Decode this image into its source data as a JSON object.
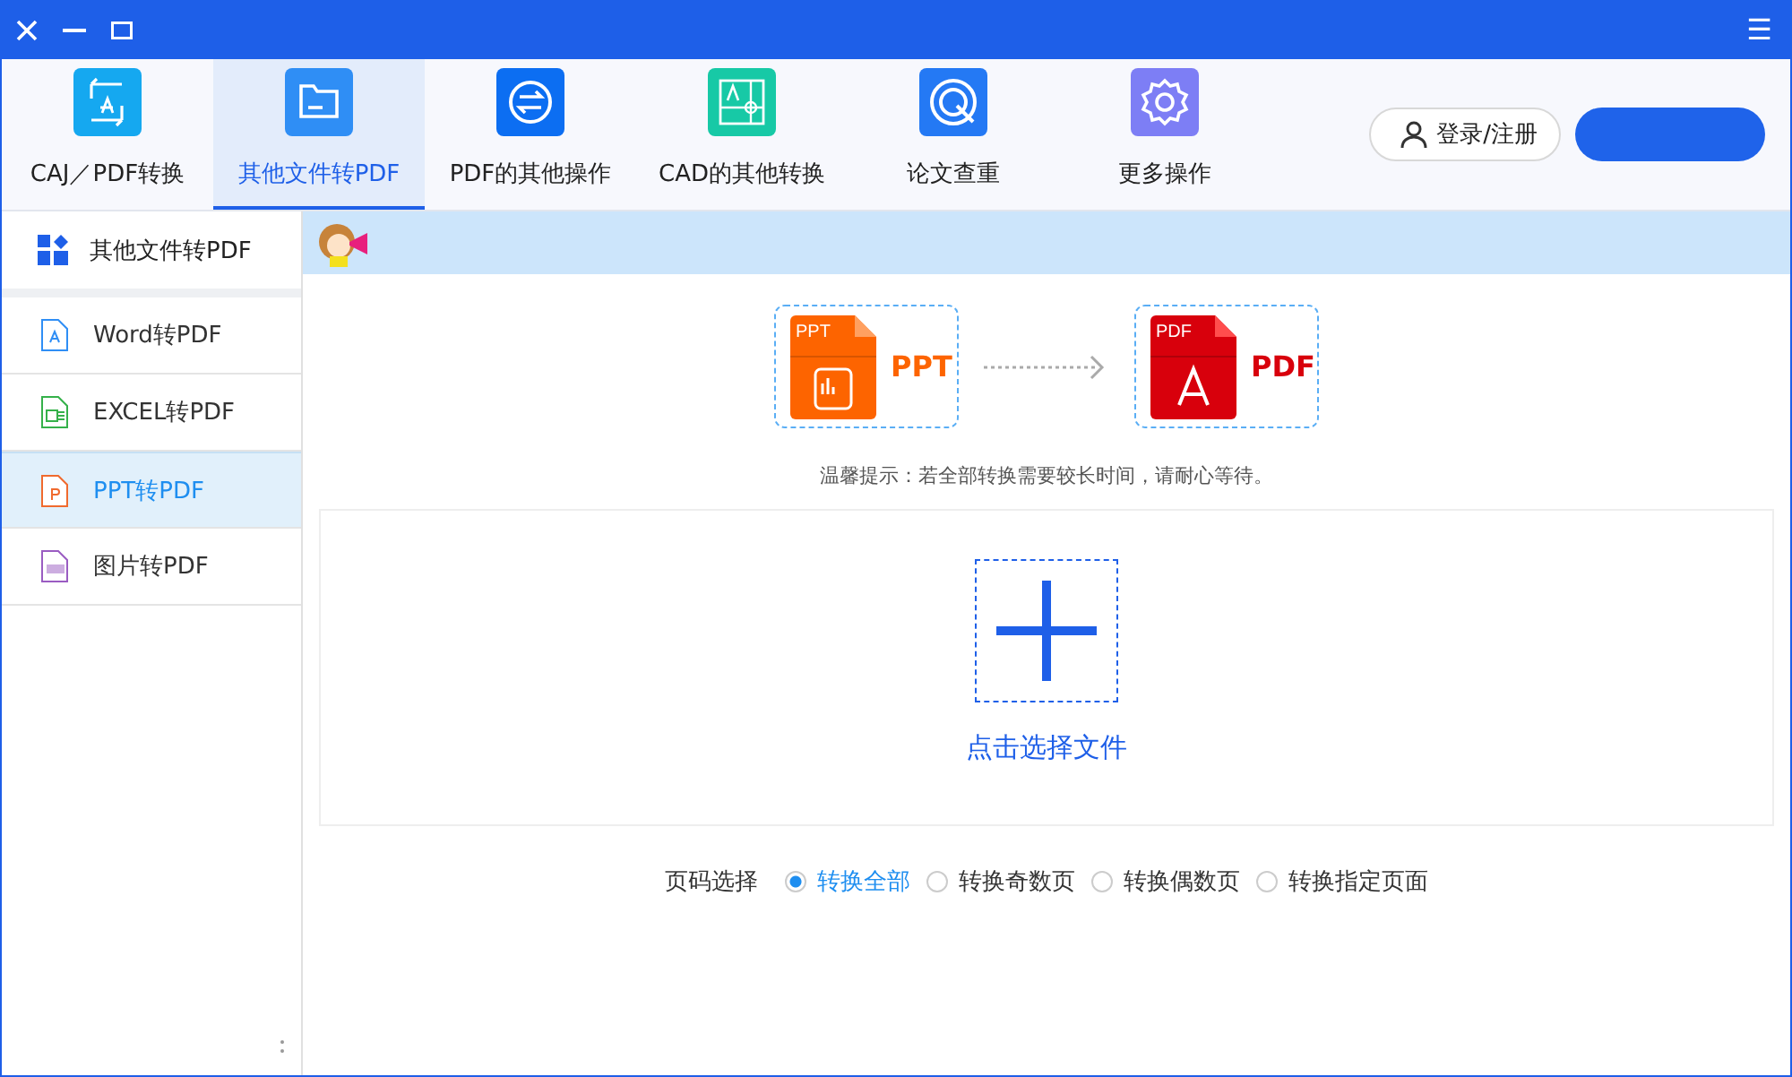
{
  "window": {
    "menu_glyph": "☰"
  },
  "tabs": [
    {
      "label": "CAJ／PDF转换",
      "kind": "caj",
      "selected": false
    },
    {
      "label": "其他文件转PDF",
      "kind": "folder",
      "selected": true
    },
    {
      "label": "PDF的其他操作",
      "kind": "swap",
      "selected": false
    },
    {
      "label": "CAD的其他转换",
      "kind": "cad",
      "selected": false
    },
    {
      "label": "论文查重",
      "kind": "check",
      "selected": false
    },
    {
      "label": "更多操作",
      "kind": "gear",
      "selected": false
    }
  ],
  "login_button": "登录/注册",
  "sidebar": {
    "header": "其他文件转PDF",
    "items": [
      {
        "label": "Word转PDF",
        "kind": "word",
        "selected": false
      },
      {
        "label": "EXCEL转PDF",
        "kind": "excel",
        "selected": false
      },
      {
        "label": "PPT转PDF",
        "kind": "ppt",
        "selected": true
      },
      {
        "label": "图片转PDF",
        "kind": "jpg",
        "selected": false
      }
    ]
  },
  "conversion": {
    "from": {
      "badge": "PPT",
      "label": "PPT"
    },
    "to": {
      "badge": "PDF",
      "label": "PDF"
    }
  },
  "hint": "温馨提示：若全部转换需要较长时间，请耐心等待。",
  "drop_label": "点击选择文件",
  "page_select": {
    "label": "页码选择",
    "options": [
      {
        "label": "转换全部",
        "selected": true
      },
      {
        "label": "转换奇数页",
        "selected": false
      },
      {
        "label": "转换偶数页",
        "selected": false
      },
      {
        "label": "转换指定页面",
        "selected": false
      }
    ]
  }
}
